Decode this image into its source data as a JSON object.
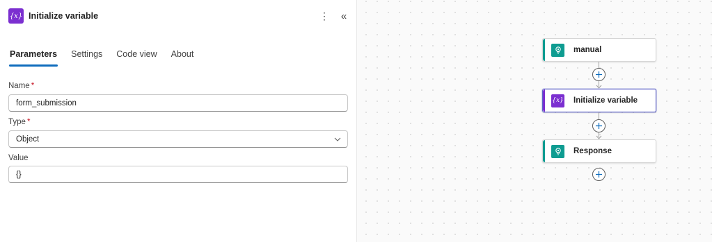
{
  "panel": {
    "icon_text": "{x}",
    "title": "Initialize variable",
    "more_glyph": "⋮",
    "collapse_glyph": "«"
  },
  "tabs": [
    {
      "label": "Parameters",
      "active": true
    },
    {
      "label": "Settings",
      "active": false
    },
    {
      "label": "Code view",
      "active": false
    },
    {
      "label": "About",
      "active": false
    }
  ],
  "fields": {
    "name": {
      "label": "Name",
      "required_mark": "*",
      "value": "form_submission"
    },
    "type": {
      "label": "Type",
      "required_mark": "*",
      "value": "Object"
    },
    "value": {
      "label": "Value",
      "value": "{}"
    }
  },
  "canvas": {
    "nodes": [
      {
        "label": "manual",
        "icon": "request-trigger-icon",
        "color": "#0e9c91"
      },
      {
        "label": "Initialize variable",
        "icon_text": "{x}",
        "color": "#7b2fd0",
        "selected": true
      },
      {
        "label": "Response",
        "icon": "response-icon",
        "color": "#0e9c91"
      }
    ]
  },
  "colors": {
    "accent": "#0f6cbd",
    "variable_purple": "#7b2fd0",
    "request_teal": "#0e9c91",
    "required_red": "#c50f1f"
  }
}
